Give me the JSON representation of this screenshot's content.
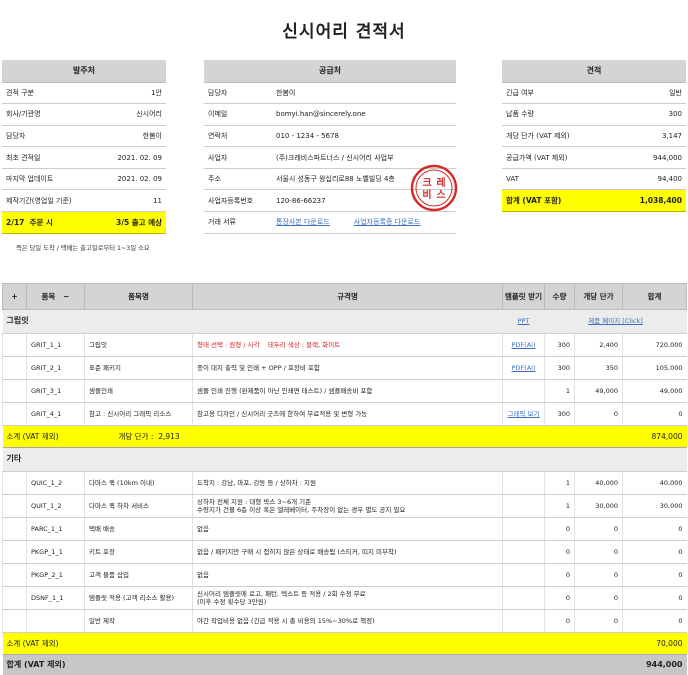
{
  "title": "신시어리 견적서",
  "orderer": {
    "header": "발주처",
    "rows": [
      {
        "label": "견적 구분",
        "value": "1안"
      },
      {
        "label": "회사/기관명",
        "value": "신시어리"
      },
      {
        "label": "담당자",
        "value": "한봄이"
      },
      {
        "label": "최초 견적일",
        "value": "2021. 02. 09"
      },
      {
        "label": "마지막 업데이트",
        "value": "2021. 02. 09"
      },
      {
        "label": "제작기간(영업일 기준)",
        "value": "11"
      }
    ],
    "highlight": {
      "date": "2/17",
      "label": "주문 시",
      "value": "3/5 출고 예상"
    },
    "note": "즉은 당일 도착 / 택배는 출고일로부터 1~3일 소요"
  },
  "supplier": {
    "header": "공급처",
    "rows": [
      {
        "label": "담당자",
        "value": "한봄이"
      },
      {
        "label": "이메일",
        "value": "bomyi.han@sincerely.one"
      },
      {
        "label": "연락처",
        "value": "010 - 1234 - 5678"
      },
      {
        "label": "사업자",
        "value": "(주)크레비스파트너스 / 신시어리 사업부"
      },
      {
        "label": "주소",
        "value": "서울시 성동구 왕십리로88 노벨빌딩 4층"
      },
      {
        "label": "사업자등록번호",
        "value": "120-86-66237"
      }
    ],
    "docs": {
      "label": "거래 서류",
      "link1": "통장사본 다운로드",
      "link2": "사업자등록증 다운로드"
    }
  },
  "estimate": {
    "header": "견적",
    "rows": [
      {
        "label": "긴급 여부",
        "value": "일반"
      },
      {
        "label": "납품 수량",
        "value": "300"
      },
      {
        "label": "개당 단가 (VAT 제외)",
        "value": "3,147"
      },
      {
        "label": "공급가액 (VAT 제외)",
        "value": "944,000"
      },
      {
        "label": "VAT",
        "value": "94,400"
      }
    ],
    "total": {
      "label": "합계 (VAT 포함)",
      "value": "1,038,400"
    }
  },
  "seal": {
    "chars": [
      "크",
      "레",
      "비",
      "스"
    ]
  },
  "items": {
    "headers": {
      "toggle": "+",
      "code": "품목",
      "collapse": "−",
      "name": "품목명",
      "spec": "규격명",
      "template": "템플릿 받기",
      "qty": "수량",
      "unit": "개당 단가",
      "sum": "합계"
    },
    "group1": {
      "name": "그립잇",
      "link1": "PPT",
      "link2": "제품 페이지 [Click]",
      "rows": [
        {
          "code": "GRIT_1_1",
          "name": "그립잇",
          "spec_a": "형태 선택 : 원형 / 사각",
          "spec_b": "테두리 색상 : 블랙, 화이트",
          "tpl": "PDF(Ai)",
          "qty": "300",
          "unit": "2,400",
          "sum": "720,000"
        },
        {
          "code": "GRIT_2_1",
          "name": "표준 패키지",
          "spec": "종이 대지 출력 및 인쇄 + OPP / 포장비 포함",
          "tpl": "PDF(Ai)",
          "qty": "300",
          "unit": "350",
          "sum": "105,000"
        },
        {
          "code": "GRIT_3_1",
          "name": "샘플인쇄",
          "spec": "샘플 인쇄 진행 (완제품이 아닌 인쇄면 테스트) / 샘플배송비 포함",
          "tpl": "",
          "qty": "1",
          "unit": "49,000",
          "sum": "49,000"
        },
        {
          "code": "GRIT_4_1",
          "name": "참고 : 신시어리 그래픽 리소스",
          "spec": "참고용 디자인 / 신시어리 굿즈에 한하여 무료적용 및 변형 가능",
          "tpl": "그래픽 보기",
          "qty": "300",
          "unit": "0",
          "sum": "0"
        }
      ],
      "subtotal": {
        "label": "소계 (VAT 제외)",
        "unit_label": "개당 단가 :",
        "unit_value": "2,913",
        "sum": "874,000"
      }
    },
    "group2": {
      "name": "기타",
      "rows": [
        {
          "code": "QUIC_1_2",
          "name": "다마스 퀵 (10km 이내)",
          "spec": "도착지 : 강남, 마포, 강동 등 / 상하차 : 지원",
          "qty": "1",
          "unit": "40,000",
          "sum": "40,000"
        },
        {
          "code": "QUIT_1_2",
          "name": "다마스 퀵 하차 서비스",
          "spec1": "상하차 전체 지원 : 대형 박스 3~6개 기준",
          "spec2": "수령지가 건물 6층 이상 혹은 엘레베이터, 주차장이 없는 경우 별도 공지 필요",
          "qty": "1",
          "unit": "30,000",
          "sum": "30,000"
        },
        {
          "code": "PARC_1_1",
          "name": "택배 배송",
          "spec": "없음",
          "qty": "0",
          "unit": "0",
          "sum": "0"
        },
        {
          "code": "PKGP_1_1",
          "name": "키트 포장",
          "spec": "없음 / 패키지만 구매 시 접히지 않은 상태로 배송됨 (스티커, 띠지 미부착)",
          "qty": "0",
          "unit": "0",
          "sum": "0"
        },
        {
          "code": "PKGP_2_1",
          "name": "고객 물품 삽입",
          "spec": "없음",
          "qty": "0",
          "unit": "0",
          "sum": "0"
        },
        {
          "code": "DSNF_1_1",
          "name": "템플릿 적용 (고객 리소스 활용)",
          "spec1": "신시어리 템플릿에 로고, 패턴, 텍스트 등 적용 / 2회 수정 무료",
          "spec2": "(이후 수정 횟수당 3만원)",
          "qty": "0",
          "unit": "0",
          "sum": "0"
        },
        {
          "code": "",
          "name": "일반 제작",
          "spec": "야간 작업비용 없음 (긴급 적용 시 총 비용의 15%~30%로 책정)",
          "qty": "0",
          "unit": "0",
          "sum": "0"
        }
      ],
      "subtotal": {
        "label": "소계 (VAT 제외)",
        "sum": "70,000"
      }
    },
    "total": {
      "label": "합계 (VAT 제외)",
      "sum": "944,000"
    }
  }
}
